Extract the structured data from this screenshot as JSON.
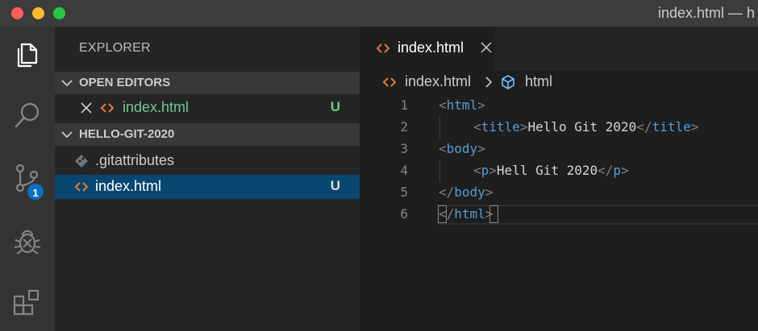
{
  "window": {
    "title": "index.html — h"
  },
  "activity_bar": {
    "icons": [
      "files-icon",
      "search-icon",
      "source-control-icon",
      "debug-icon",
      "extensions-icon"
    ],
    "source_control_badge": "1"
  },
  "sidebar": {
    "title": "EXPLORER",
    "open_editors": {
      "label": "OPEN EDITORS",
      "items": [
        {
          "name": "index.html",
          "status": "U"
        }
      ]
    },
    "folder": {
      "label": "HELLO-GIT-2020",
      "items": [
        {
          "name": ".gitattributes",
          "status": ""
        },
        {
          "name": "index.html",
          "status": "U"
        }
      ]
    }
  },
  "editor": {
    "tab": {
      "label": "index.html"
    },
    "breadcrumb": {
      "file": "index.html",
      "symbol": "html"
    },
    "lines": [
      {
        "num": "1",
        "open": "<",
        "tag": "html",
        "close": ">"
      },
      {
        "num": "2",
        "open1": "<",
        "tag1": "title",
        "close1": ">",
        "text": "Hello Git 2020",
        "open2": "</",
        "tag2": "title",
        "close2": ">"
      },
      {
        "num": "3",
        "open": "<",
        "tag": "body",
        "close": ">"
      },
      {
        "num": "4",
        "open1": "<",
        "tag1": "p",
        "close1": ">",
        "text": "Hell Git 2020",
        "open2": "</",
        "tag2": "p",
        "close2": ">"
      },
      {
        "num": "5",
        "open": "</",
        "tag": "body",
        "close": ">"
      },
      {
        "num": "6",
        "open": "</",
        "tag": "html",
        "close": ">"
      }
    ]
  },
  "colors": {
    "accent_badge": "#0e6fc3",
    "untracked_green": "#73c991",
    "selection_blue": "#094771",
    "html_icon_orange": "#e37933",
    "tag_blue": "#569cd6"
  }
}
